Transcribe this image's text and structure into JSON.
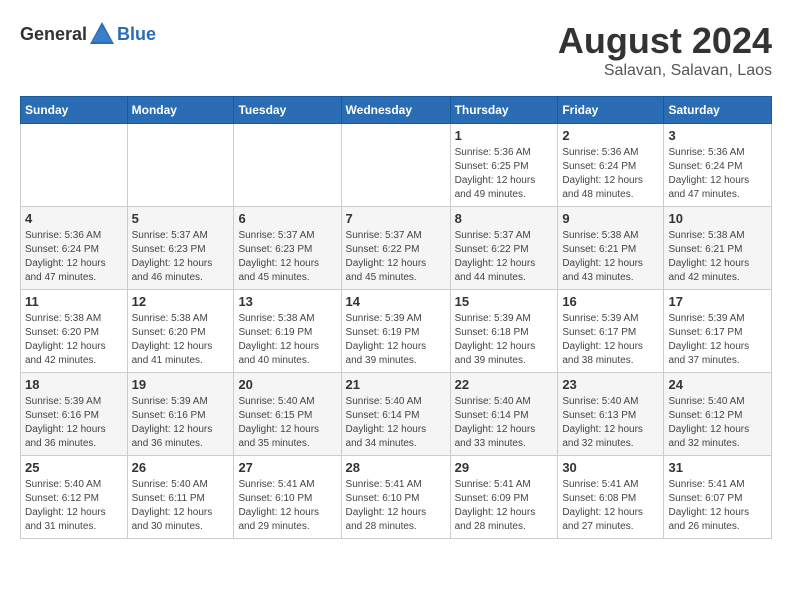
{
  "header": {
    "logo_general": "General",
    "logo_blue": "Blue",
    "month_year": "August 2024",
    "location": "Salavan, Salavan, Laos"
  },
  "weekdays": [
    "Sunday",
    "Monday",
    "Tuesday",
    "Wednesday",
    "Thursday",
    "Friday",
    "Saturday"
  ],
  "weeks": [
    [
      {
        "day": "",
        "info": ""
      },
      {
        "day": "",
        "info": ""
      },
      {
        "day": "",
        "info": ""
      },
      {
        "day": "",
        "info": ""
      },
      {
        "day": "1",
        "info": "Sunrise: 5:36 AM\nSunset: 6:25 PM\nDaylight: 12 hours\nand 49 minutes."
      },
      {
        "day": "2",
        "info": "Sunrise: 5:36 AM\nSunset: 6:24 PM\nDaylight: 12 hours\nand 48 minutes."
      },
      {
        "day": "3",
        "info": "Sunrise: 5:36 AM\nSunset: 6:24 PM\nDaylight: 12 hours\nand 47 minutes."
      }
    ],
    [
      {
        "day": "4",
        "info": "Sunrise: 5:36 AM\nSunset: 6:24 PM\nDaylight: 12 hours\nand 47 minutes."
      },
      {
        "day": "5",
        "info": "Sunrise: 5:37 AM\nSunset: 6:23 PM\nDaylight: 12 hours\nand 46 minutes."
      },
      {
        "day": "6",
        "info": "Sunrise: 5:37 AM\nSunset: 6:23 PM\nDaylight: 12 hours\nand 45 minutes."
      },
      {
        "day": "7",
        "info": "Sunrise: 5:37 AM\nSunset: 6:22 PM\nDaylight: 12 hours\nand 45 minutes."
      },
      {
        "day": "8",
        "info": "Sunrise: 5:37 AM\nSunset: 6:22 PM\nDaylight: 12 hours\nand 44 minutes."
      },
      {
        "day": "9",
        "info": "Sunrise: 5:38 AM\nSunset: 6:21 PM\nDaylight: 12 hours\nand 43 minutes."
      },
      {
        "day": "10",
        "info": "Sunrise: 5:38 AM\nSunset: 6:21 PM\nDaylight: 12 hours\nand 42 minutes."
      }
    ],
    [
      {
        "day": "11",
        "info": "Sunrise: 5:38 AM\nSunset: 6:20 PM\nDaylight: 12 hours\nand 42 minutes."
      },
      {
        "day": "12",
        "info": "Sunrise: 5:38 AM\nSunset: 6:20 PM\nDaylight: 12 hours\nand 41 minutes."
      },
      {
        "day": "13",
        "info": "Sunrise: 5:38 AM\nSunset: 6:19 PM\nDaylight: 12 hours\nand 40 minutes."
      },
      {
        "day": "14",
        "info": "Sunrise: 5:39 AM\nSunset: 6:19 PM\nDaylight: 12 hours\nand 39 minutes."
      },
      {
        "day": "15",
        "info": "Sunrise: 5:39 AM\nSunset: 6:18 PM\nDaylight: 12 hours\nand 39 minutes."
      },
      {
        "day": "16",
        "info": "Sunrise: 5:39 AM\nSunset: 6:17 PM\nDaylight: 12 hours\nand 38 minutes."
      },
      {
        "day": "17",
        "info": "Sunrise: 5:39 AM\nSunset: 6:17 PM\nDaylight: 12 hours\nand 37 minutes."
      }
    ],
    [
      {
        "day": "18",
        "info": "Sunrise: 5:39 AM\nSunset: 6:16 PM\nDaylight: 12 hours\nand 36 minutes."
      },
      {
        "day": "19",
        "info": "Sunrise: 5:39 AM\nSunset: 6:16 PM\nDaylight: 12 hours\nand 36 minutes."
      },
      {
        "day": "20",
        "info": "Sunrise: 5:40 AM\nSunset: 6:15 PM\nDaylight: 12 hours\nand 35 minutes."
      },
      {
        "day": "21",
        "info": "Sunrise: 5:40 AM\nSunset: 6:14 PM\nDaylight: 12 hours\nand 34 minutes."
      },
      {
        "day": "22",
        "info": "Sunrise: 5:40 AM\nSunset: 6:14 PM\nDaylight: 12 hours\nand 33 minutes."
      },
      {
        "day": "23",
        "info": "Sunrise: 5:40 AM\nSunset: 6:13 PM\nDaylight: 12 hours\nand 32 minutes."
      },
      {
        "day": "24",
        "info": "Sunrise: 5:40 AM\nSunset: 6:12 PM\nDaylight: 12 hours\nand 32 minutes."
      }
    ],
    [
      {
        "day": "25",
        "info": "Sunrise: 5:40 AM\nSunset: 6:12 PM\nDaylight: 12 hours\nand 31 minutes."
      },
      {
        "day": "26",
        "info": "Sunrise: 5:40 AM\nSunset: 6:11 PM\nDaylight: 12 hours\nand 30 minutes."
      },
      {
        "day": "27",
        "info": "Sunrise: 5:41 AM\nSunset: 6:10 PM\nDaylight: 12 hours\nand 29 minutes."
      },
      {
        "day": "28",
        "info": "Sunrise: 5:41 AM\nSunset: 6:10 PM\nDaylight: 12 hours\nand 28 minutes."
      },
      {
        "day": "29",
        "info": "Sunrise: 5:41 AM\nSunset: 6:09 PM\nDaylight: 12 hours\nand 28 minutes."
      },
      {
        "day": "30",
        "info": "Sunrise: 5:41 AM\nSunset: 6:08 PM\nDaylight: 12 hours\nand 27 minutes."
      },
      {
        "day": "31",
        "info": "Sunrise: 5:41 AM\nSunset: 6:07 PM\nDaylight: 12 hours\nand 26 minutes."
      }
    ]
  ]
}
